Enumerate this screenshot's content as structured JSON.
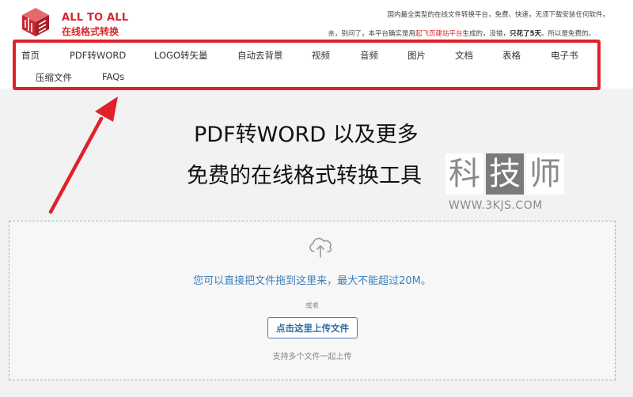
{
  "brand": {
    "name_en": "ALL TO ALL",
    "name_cn": "在线格式转换",
    "logo_icon": "cube-logo-icon",
    "brand_color": "#d9272e"
  },
  "tagline": {
    "line1": "国内最全类型的在线文件转换平台，免费、快速，无须下载安装任何软件。",
    "line2_a": "亲，别问了，本平台确实是用",
    "line2_highlight": "起飞页建站平台",
    "line2_b": "生成的，没错，",
    "line2_bold": "只花了5天",
    "line2_c": "。所以是免费的。"
  },
  "nav": {
    "items": [
      {
        "label": "首页"
      },
      {
        "label": "PDF转WORD"
      },
      {
        "label": "LOGO转矢量"
      },
      {
        "label": "自动去背景"
      },
      {
        "label": "视频"
      },
      {
        "label": "音频"
      },
      {
        "label": "图片"
      },
      {
        "label": "文档"
      },
      {
        "label": "表格"
      },
      {
        "label": "电子书"
      },
      {
        "label": "压缩文件"
      },
      {
        "label": "FAQs"
      }
    ],
    "highlight_color": "#e0212a"
  },
  "hero": {
    "title_line1": "PDF转WORD 以及更多",
    "title_line2": "免费的在线格式转换工具"
  },
  "watermark": {
    "chars": [
      "科",
      "技",
      "师"
    ],
    "url": "WWW.3KJS.COM"
  },
  "upload": {
    "icon": "cloud-upload-icon",
    "drop_text": "您可以直接把文件拖到这里来，最大不能超过20M。",
    "or_text": "或者",
    "button_label": "点击这里上传文件",
    "multi_text": "支持多个文件一起上传",
    "accent_color": "#3a7fbf"
  }
}
